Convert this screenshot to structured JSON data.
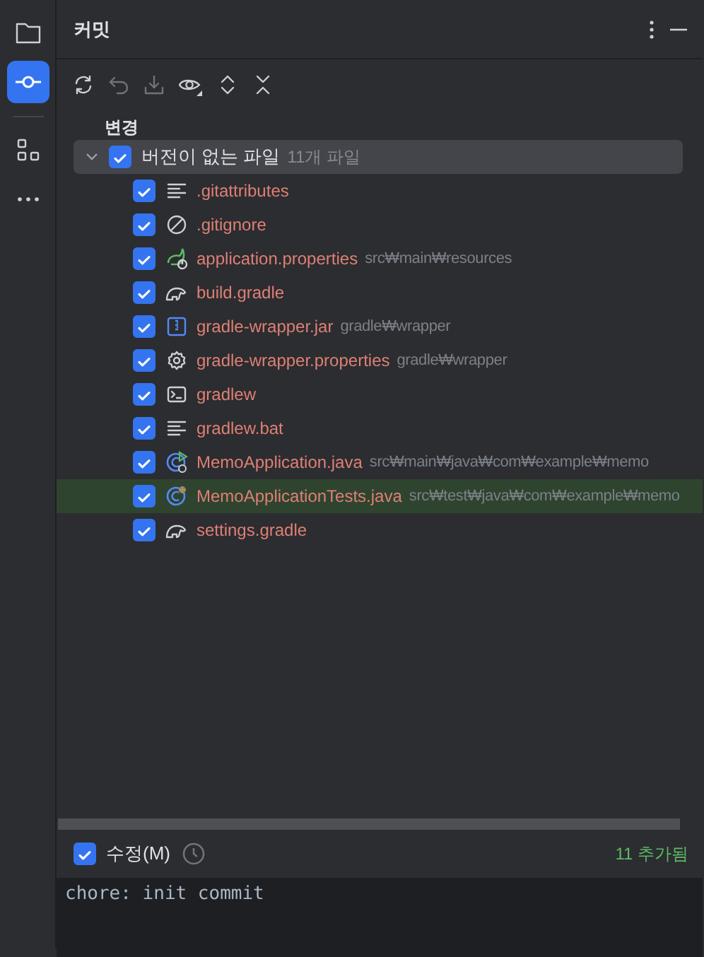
{
  "sidebar": {
    "items": [
      {
        "kind": "folder",
        "selected": false
      },
      {
        "kind": "commit",
        "selected": true
      },
      {
        "kind": "structure",
        "selected": false
      },
      {
        "kind": "more",
        "selected": false
      }
    ]
  },
  "panel": {
    "title": "커밋"
  },
  "toolbar": [
    {
      "kind": "refresh",
      "disabled": false
    },
    {
      "kind": "undo",
      "disabled": true
    },
    {
      "kind": "download",
      "disabled": true
    },
    {
      "kind": "eye",
      "disabled": false
    },
    {
      "kind": "expand",
      "disabled": false
    },
    {
      "kind": "collapse",
      "disabled": false
    }
  ],
  "changes": {
    "heading": "변경",
    "group": {
      "label": "버전이 없는 파일",
      "count": "11개 파일",
      "checked": true,
      "expanded": true
    },
    "files": [
      {
        "name": ".gitattributes",
        "kind": "text",
        "checked": true,
        "selected": false
      },
      {
        "name": ".gitignore",
        "kind": "ignore",
        "checked": true,
        "selected": false
      },
      {
        "name": "application.properties",
        "path": "src₩main₩resources",
        "kind": "spring",
        "checked": true,
        "selected": false
      },
      {
        "name": "build.gradle",
        "kind": "gradle",
        "checked": true,
        "selected": false
      },
      {
        "name": "gradle-wrapper.jar",
        "path": "gradle₩wrapper",
        "kind": "jar",
        "checked": true,
        "selected": false
      },
      {
        "name": "gradle-wrapper.properties",
        "path": "gradle₩wrapper",
        "kind": "settings",
        "checked": true,
        "selected": false
      },
      {
        "name": "gradlew",
        "kind": "terminal",
        "checked": true,
        "selected": false
      },
      {
        "name": "gradlew.bat",
        "kind": "text",
        "checked": true,
        "selected": false
      },
      {
        "name": "MemoApplication.java",
        "path": "src₩main₩java₩com₩example₩memo",
        "kind": "app-class",
        "checked": true,
        "selected": false
      },
      {
        "name": "MemoApplicationTests.java",
        "path": "src₩test₩java₩com₩example₩memo",
        "kind": "test-class",
        "checked": true,
        "selected": true
      },
      {
        "name": "settings.gradle",
        "kind": "gradle",
        "checked": true,
        "selected": false
      }
    ]
  },
  "amend": {
    "label": "수정(M)",
    "checked": true
  },
  "summary": "11 추가됨",
  "message": "chore: init commit"
}
